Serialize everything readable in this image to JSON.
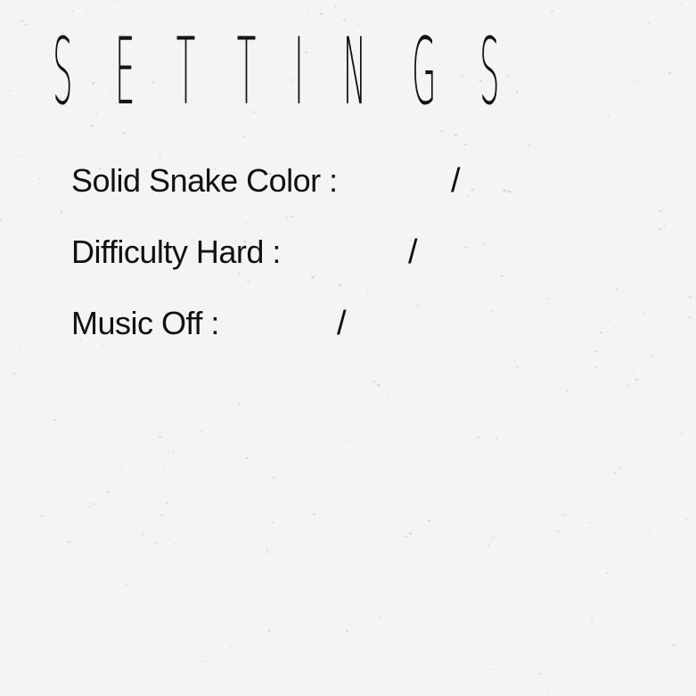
{
  "header": {
    "title_letters": [
      "S",
      "E",
      "T",
      "T",
      "I",
      "N",
      "G",
      "S"
    ]
  },
  "settings": [
    {
      "label": "Solid Snake Color :",
      "separator": "/"
    },
    {
      "label": "Difficulty Hard :",
      "separator": "/"
    },
    {
      "label": "Music Off :",
      "separator": "/"
    }
  ],
  "colors": {
    "background": "#f4f4f4",
    "text": "#111111",
    "speckle": "#f2b6c6"
  }
}
